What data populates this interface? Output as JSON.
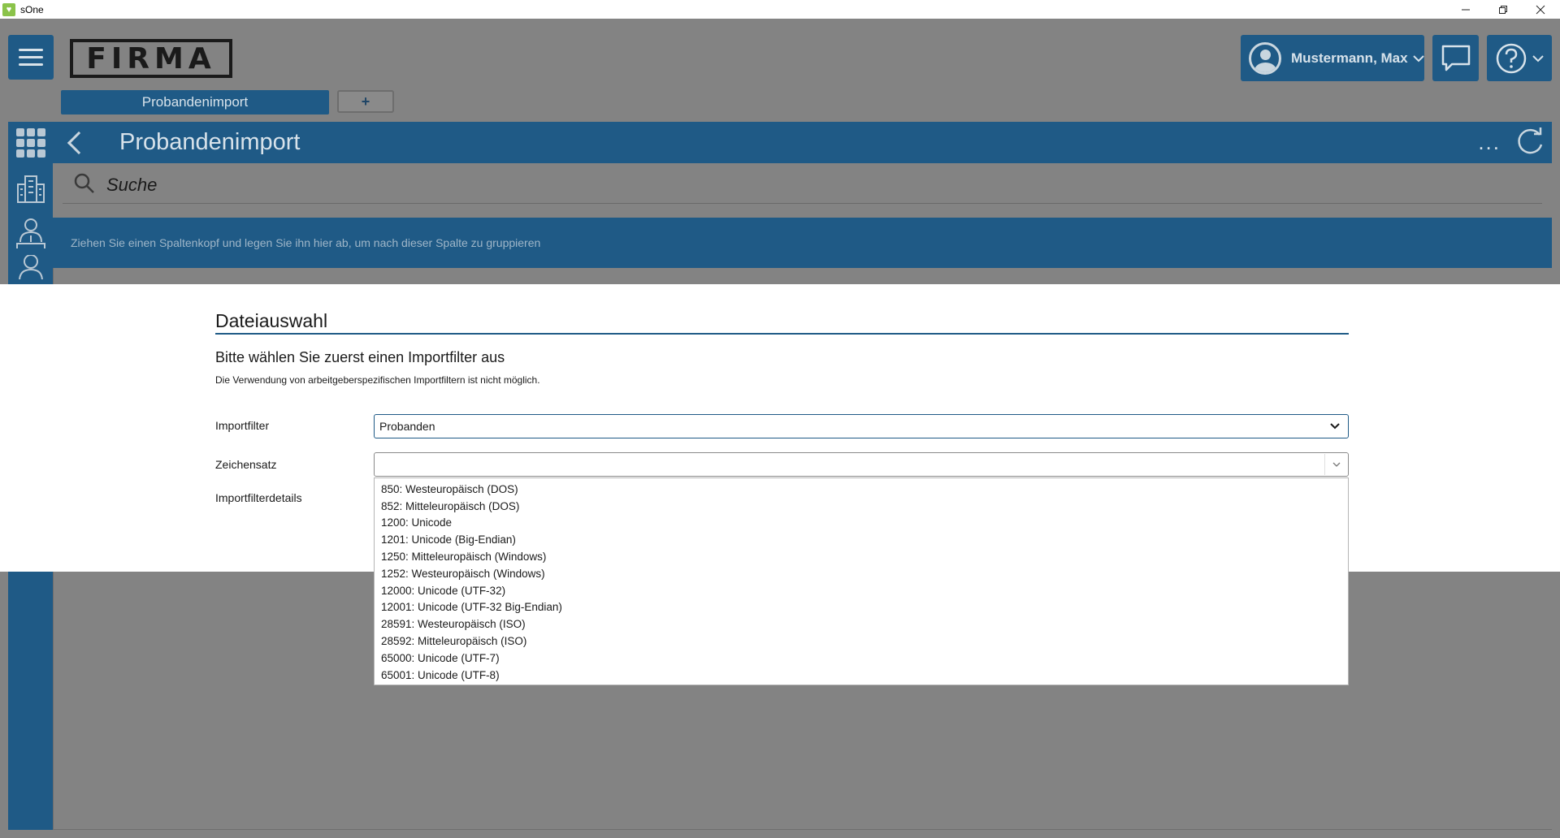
{
  "window": {
    "title": "sOne",
    "icon": "app-logo-icon",
    "controls": [
      "minimize-icon",
      "restore-icon",
      "close-icon"
    ]
  },
  "header": {
    "logo_text": "FIRMA",
    "tabs": [
      {
        "label": "Probandenimport",
        "active": true
      },
      {
        "label": "+"
      }
    ],
    "user_label": "Mustermann, Max"
  },
  "page": {
    "title": "Probandenimport",
    "more_label": "...",
    "search_placeholder": "Suche",
    "group_hint": "Ziehen Sie einen Spaltenkopf und legen Sie ihn hier ab, um nach dieser Spalte zu gruppieren"
  },
  "dialog": {
    "title": "Dateiauswahl",
    "subtitle": "Bitte wählen Sie zuerst einen Importfilter aus",
    "note": "Die Verwendung von arbeitgeberspezifischen Importfiltern ist nicht möglich.",
    "fields": {
      "importfilter_label": "Importfilter",
      "importfilter_value": "Probanden",
      "zeichensatz_label": "Zeichensatz",
      "zeichensatz_value": "",
      "details_label": "Importfilterdetails"
    },
    "charset_options": [
      "850: Westeuropäisch (DOS)",
      "852: Mitteleuropäisch (DOS)",
      "1200: Unicode",
      "1201: Unicode (Big-Endian)",
      "1250: Mitteleuropäisch (Windows)",
      "1252: Westeuropäisch (Windows)",
      "12000: Unicode (UTF-32)",
      "12001: Unicode (UTF-32 Big-Endian)",
      "28591: Westeuropäisch (ISO)",
      "28592: Mitteleuropäisch (ISO)",
      "65000: Unicode (UTF-7)",
      "65001: Unicode (UTF-8)"
    ]
  },
  "colors": {
    "brand": "#1f5a86",
    "overlay": "#838383"
  }
}
